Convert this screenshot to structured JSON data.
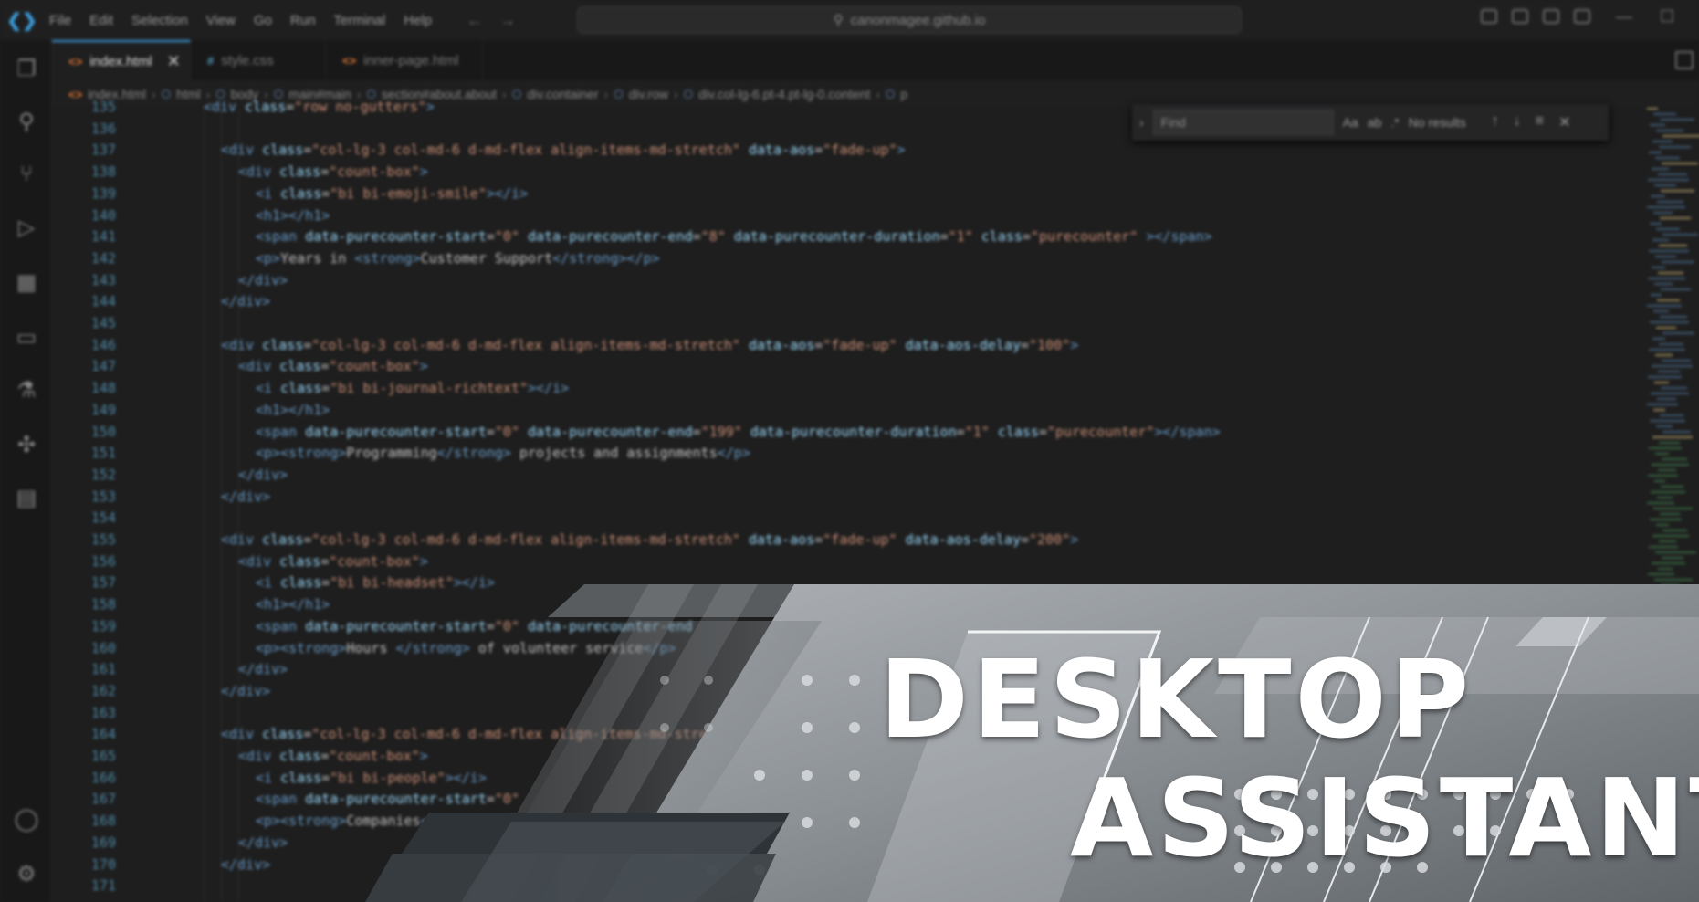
{
  "menu": [
    "File",
    "Edit",
    "Selection",
    "View",
    "Go",
    "Run",
    "Terminal",
    "Help"
  ],
  "search_text": "canonmagee.github.io",
  "tabs": [
    {
      "label": "index.html",
      "icon": "html-file-icon",
      "active": true
    },
    {
      "label": "style.css",
      "icon": "css-file-icon",
      "active": false
    },
    {
      "label": "inner-page.html",
      "icon": "html-file-icon",
      "active": false
    }
  ],
  "breadcrumb": [
    "index.html",
    "html",
    "body",
    "main#main",
    "section#about.about",
    "div.container",
    "div.row",
    "div.col-lg-6.pt-4.pt-lg-0.content",
    "p"
  ],
  "find": {
    "placeholder": "Find",
    "opt_case": "Aa",
    "opt_word": "ab",
    "opt_regex": ".*",
    "result": "No results"
  },
  "code_lines": [
    {
      "n": "135",
      "indent": 0,
      "html": "<span class='t'>&lt;div</span> <span class='a'>class</span>=<span class='s'>\"row no-gutters\"</span><span class='t'>&gt;</span>"
    },
    {
      "n": "136",
      "indent": 0,
      "html": ""
    },
    {
      "n": "137",
      "indent": 1,
      "html": "<span class='t'>&lt;div</span> <span class='a'>class</span>=<span class='s'>\"col-lg-3 col-md-6 d-md-flex align-items-md-stretch\"</span> <span class='a'>data-aos</span>=<span class='s'>\"fade-up\"</span><span class='t'>&gt;</span>"
    },
    {
      "n": "138",
      "indent": 2,
      "html": "<span class='t'>&lt;div</span> <span class='a'>class</span>=<span class='s'>\"count-box\"</span><span class='t'>&gt;</span>"
    },
    {
      "n": "139",
      "indent": 3,
      "html": "<span class='t'>&lt;i</span> <span class='a'>class</span>=<span class='s'>\"bi bi-emoji-smile\"</span><span class='t'>&gt;&lt;/i&gt;</span>"
    },
    {
      "n": "140",
      "indent": 3,
      "html": "<span class='t'>&lt;h1&gt;&lt;/h1&gt;</span>"
    },
    {
      "n": "141",
      "indent": 3,
      "html": "<span class='t'>&lt;span</span> <span class='a'>data-purecounter-start</span>=<span class='s'>\"0\"</span> <span class='a'>data-purecounter-end</span>=<span class='s'>\"8\"</span> <span class='a'>data-purecounter-duration</span>=<span class='s'>\"1\"</span> <span class='a'>class</span>=<span class='s'>\"purecounter\"</span> <span class='t'>&gt;&lt;/span&gt;</span>"
    },
    {
      "n": "142",
      "indent": 3,
      "html": "<span class='t'>&lt;p&gt;</span>Years in <span class='t'>&lt;strong&gt;</span>Customer Support<span class='t'>&lt;/strong&gt;&lt;/p&gt;</span>"
    },
    {
      "n": "143",
      "indent": 2,
      "html": "<span class='t'>&lt;/div&gt;</span>"
    },
    {
      "n": "144",
      "indent": 1,
      "html": "<span class='t'>&lt;/div&gt;</span>"
    },
    {
      "n": "145",
      "indent": 0,
      "html": ""
    },
    {
      "n": "146",
      "indent": 1,
      "html": "<span class='t'>&lt;div</span> <span class='a'>class</span>=<span class='s'>\"col-lg-3 col-md-6 d-md-flex align-items-md-stretch\"</span> <span class='a'>data-aos</span>=<span class='s'>\"fade-up\"</span> <span class='a'>data-aos-delay</span>=<span class='s'>\"100\"</span><span class='t'>&gt;</span>"
    },
    {
      "n": "147",
      "indent": 2,
      "html": "<span class='t'>&lt;div</span> <span class='a'>class</span>=<span class='s'>\"count-box\"</span><span class='t'>&gt;</span>"
    },
    {
      "n": "148",
      "indent": 3,
      "html": "<span class='t'>&lt;i</span> <span class='a'>class</span>=<span class='s'>\"bi bi-journal-richtext\"</span><span class='t'>&gt;&lt;/i&gt;</span>"
    },
    {
      "n": "149",
      "indent": 3,
      "html": "<span class='t'>&lt;h1&gt;&lt;/h1&gt;</span>"
    },
    {
      "n": "150",
      "indent": 3,
      "html": "<span class='t'>&lt;span</span> <span class='a'>data-purecounter-start</span>=<span class='s'>\"0\"</span> <span class='a'>data-purecounter-end</span>=<span class='s'>\"199\"</span> <span class='a'>data-purecounter-duration</span>=<span class='s'>\"1\"</span> <span class='a'>class</span>=<span class='s'>\"purecounter\"</span><span class='t'>&gt;&lt;/span&gt;</span>"
    },
    {
      "n": "151",
      "indent": 3,
      "html": "<span class='t'>&lt;p&gt;&lt;strong&gt;</span>Programming<span class='t'>&lt;/strong&gt;</span> projects and assignments<span class='t'>&lt;/p&gt;</span>"
    },
    {
      "n": "152",
      "indent": 2,
      "html": "<span class='t'>&lt;/div&gt;</span>"
    },
    {
      "n": "153",
      "indent": 1,
      "html": "<span class='t'>&lt;/div&gt;</span>"
    },
    {
      "n": "154",
      "indent": 0,
      "html": ""
    },
    {
      "n": "155",
      "indent": 1,
      "html": "<span class='t'>&lt;div</span> <span class='a'>class</span>=<span class='s'>\"col-lg-3 col-md-6 d-md-flex align-items-md-stretch\"</span> <span class='a'>data-aos</span>=<span class='s'>\"fade-up\"</span> <span class='a'>data-aos-delay</span>=<span class='s'>\"200\"</span><span class='t'>&gt;</span>"
    },
    {
      "n": "156",
      "indent": 2,
      "html": "<span class='t'>&lt;div</span> <span class='a'>class</span>=<span class='s'>\"count-box\"</span><span class='t'>&gt;</span>"
    },
    {
      "n": "157",
      "indent": 3,
      "html": "<span class='t'>&lt;i</span> <span class='a'>class</span>=<span class='s'>\"bi bi-headset\"</span><span class='t'>&gt;&lt;/i&gt;</span>"
    },
    {
      "n": "158",
      "indent": 3,
      "html": "<span class='t'>&lt;h1&gt;&lt;/h1&gt;</span>"
    },
    {
      "n": "159",
      "indent": 3,
      "html": "<span class='t'>&lt;span</span> <span class='a'>data-purecounter-start</span>=<span class='s'>\"0\"</span> <span class='a'>data-purecounter-end</span>"
    },
    {
      "n": "160",
      "indent": 3,
      "html": "<span class='t'>&lt;p&gt;&lt;strong&gt;</span>Hours <span class='t'>&lt;/strong&gt;</span> of volunteer service<span class='t'>&lt;/p&gt;</span>"
    },
    {
      "n": "161",
      "indent": 2,
      "html": "<span class='t'>&lt;/div&gt;</span>"
    },
    {
      "n": "162",
      "indent": 1,
      "html": "<span class='t'>&lt;/div&gt;</span>"
    },
    {
      "n": "163",
      "indent": 0,
      "html": ""
    },
    {
      "n": "164",
      "indent": 1,
      "html": "<span class='t'>&lt;div</span> <span class='a'>class</span>=<span class='s'>\"col-lg-3 col-md-6 d-md-flex align-items-md-stretch\"</span>"
    },
    {
      "n": "165",
      "indent": 2,
      "html": "<span class='t'>&lt;div</span> <span class='a'>class</span>=<span class='s'>\"count-box\"</span><span class='t'>&gt;</span>"
    },
    {
      "n": "166",
      "indent": 3,
      "html": "<span class='t'>&lt;i</span> <span class='a'>class</span>=<span class='s'>\"bi bi-people\"</span><span class='t'>&gt;&lt;/i&gt;</span>"
    },
    {
      "n": "167",
      "indent": 3,
      "html": "<span class='t'>&lt;span</span> <span class='a'>data-purecounter-start</span>=<span class='s'>\"0\"</span>"
    },
    {
      "n": "168",
      "indent": 3,
      "html": "<span class='t'>&lt;p&gt;&lt;strong&gt;</span>Companies<span class='t'>&lt;/strong&gt;</span> founded<span class='t'>&lt;/p&gt;</span>"
    },
    {
      "n": "169",
      "indent": 2,
      "html": "<span class='t'>&lt;/div&gt;</span>"
    },
    {
      "n": "170",
      "indent": 1,
      "html": "<span class='t'>&lt;/div&gt;</span>"
    },
    {
      "n": "171",
      "indent": 0,
      "html": ""
    }
  ],
  "banner": {
    "line1": "DESKTOP",
    "line2": "ASSISTANT"
  },
  "colors": {
    "accent": "#3b9ddd",
    "editor_bg": "#1e1e1e",
    "banner_text": "#ffffff"
  }
}
